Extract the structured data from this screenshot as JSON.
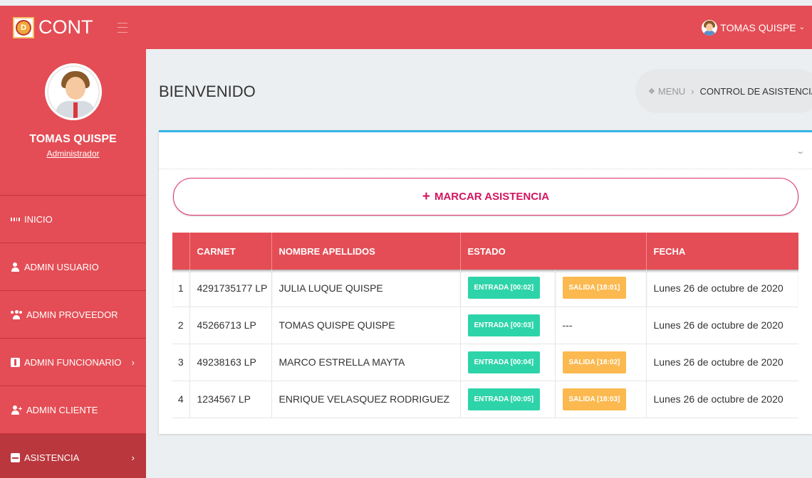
{
  "brand": {
    "name": "CONT",
    "logo_icon": "shield-logo"
  },
  "topbar": {
    "user_name": "TOMAS QUISPE",
    "chevron": "⌄"
  },
  "profile": {
    "name": "TOMAS QUISPE",
    "role": "Administrador"
  },
  "sidebar": {
    "items": [
      {
        "label": "INICIO",
        "icon": "dashboard-icon",
        "has_arrow": false
      },
      {
        "label": "ADMIN USUARIO",
        "icon": "user-icon",
        "has_arrow": false
      },
      {
        "label": "ADMIN PROVEEDOR",
        "icon": "users-icon",
        "has_arrow": false
      },
      {
        "label": "ADMIN FUNCIONARIO",
        "icon": "briefcase-icon",
        "has_arrow": true
      },
      {
        "label": "ADMIN CLIENTE",
        "icon": "user-plus-icon",
        "has_arrow": false
      },
      {
        "label": "ASISTENCIA",
        "icon": "id-card-icon",
        "has_arrow": true,
        "active": true
      }
    ],
    "arrow": "›"
  },
  "page": {
    "title": "BIENVENIDO"
  },
  "breadcrumb": {
    "home_icon": "home-icon",
    "menu": "MENU",
    "separator": "›",
    "current": "CONTROL DE ASISTENCIA"
  },
  "panel": {
    "collapse_icon": "⌄",
    "mark_button": "MARCAR ASISTENCIA",
    "mark_plus": "+"
  },
  "table": {
    "headers": [
      "",
      "CARNET",
      "NOMBRE APELLIDOS",
      "ESTADO",
      "FECHA"
    ],
    "rows": [
      {
        "num": "1",
        "carnet": "4291735177 LP",
        "nombre": "JULIA LUQUE QUISPE",
        "entrada": "ENTRADA [00:02]",
        "salida": "SALIDA [18:01]",
        "fecha": "Lunes 26 de octubre de 2020"
      },
      {
        "num": "2",
        "carnet": "45266713 LP",
        "nombre": "TOMAS QUISPE QUISPE",
        "entrada": "ENTRADA [00:03]",
        "salida": "---",
        "fecha": "Lunes 26 de octubre de 2020"
      },
      {
        "num": "3",
        "carnet": "49238163 LP",
        "nombre": "MARCO ESTRELLA MAYTA",
        "entrada": "ENTRADA [00:04]",
        "salida": "SALIDA [18:02]",
        "fecha": "Lunes 26 de octubre de 2020"
      },
      {
        "num": "4",
        "carnet": "1234567 LP",
        "nombre": "ENRIQUE VELASQUEZ RODRIGUEZ",
        "entrada": "ENTRADA [00:05]",
        "salida": "SALIDA [18:03]",
        "fecha": "Lunes 26 de octubre de 2020"
      }
    ]
  },
  "colors": {
    "primary": "#e44d55",
    "active": "#b9373d",
    "accent_line": "#34b3e4",
    "entrada": "#2dd4a9",
    "salida": "#fbb94f",
    "button_text": "#d3165d"
  }
}
